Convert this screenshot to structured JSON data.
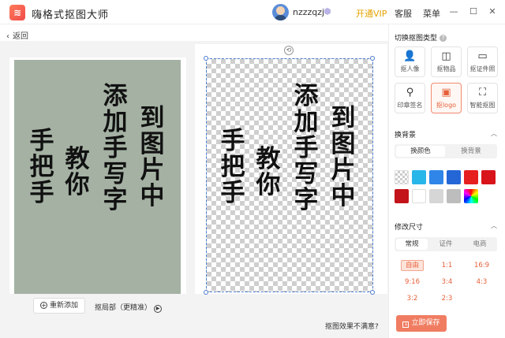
{
  "app": {
    "logo_glyph": "≋",
    "title": "嗨格式抠图大师"
  },
  "header": {
    "username": "nzzzqzj",
    "vip_label": "开通VIP",
    "service_label": "客服",
    "menu_label": "菜单",
    "colors": {
      "vip": "#e4a200"
    }
  },
  "nav": {
    "back_label": "返回"
  },
  "canvas": {
    "calligraphy": [
      "添加手写字",
      "到图片中",
      "教你",
      "手把手"
    ],
    "readd_label": "重新添加",
    "local_label": "抠局部（更精准）",
    "unhappy_label": "抠图效果不满意?"
  },
  "sidebar": {
    "cutout_type_title": "切换抠图类型",
    "types": [
      {
        "label": "抠人像",
        "icon": "person-icon"
      },
      {
        "label": "抠物品",
        "icon": "bag-icon"
      },
      {
        "label": "抠证件照",
        "icon": "id-card-icon"
      },
      {
        "label": "印章签名",
        "icon": "stamp-icon"
      },
      {
        "label": "抠logo",
        "icon": "logo-icon"
      },
      {
        "label": "智能抠图",
        "icon": "smart-scan-icon"
      }
    ],
    "active_type": "抠logo",
    "background_title": "换背景",
    "background_tabs": [
      "换颜色",
      "换背景"
    ],
    "swatches": [
      "transparent",
      "#29b6e8",
      "#2f86e8",
      "#2466d6",
      "#e61f1f",
      "#d8141a",
      "#c2141a",
      "#ffffff",
      "#d6d6d6",
      "#bdbdbd",
      "rainbow"
    ],
    "size_title": "修改尺寸",
    "size_tabs": [
      "常规",
      "证件",
      "电商"
    ],
    "ratios": [
      "自由",
      "1:1",
      "16:9",
      "9:16",
      "3:4",
      "4:3",
      "3:2",
      "2:3"
    ],
    "save_label": "立即保存",
    "colors": {
      "accent": "#f07d62"
    }
  }
}
